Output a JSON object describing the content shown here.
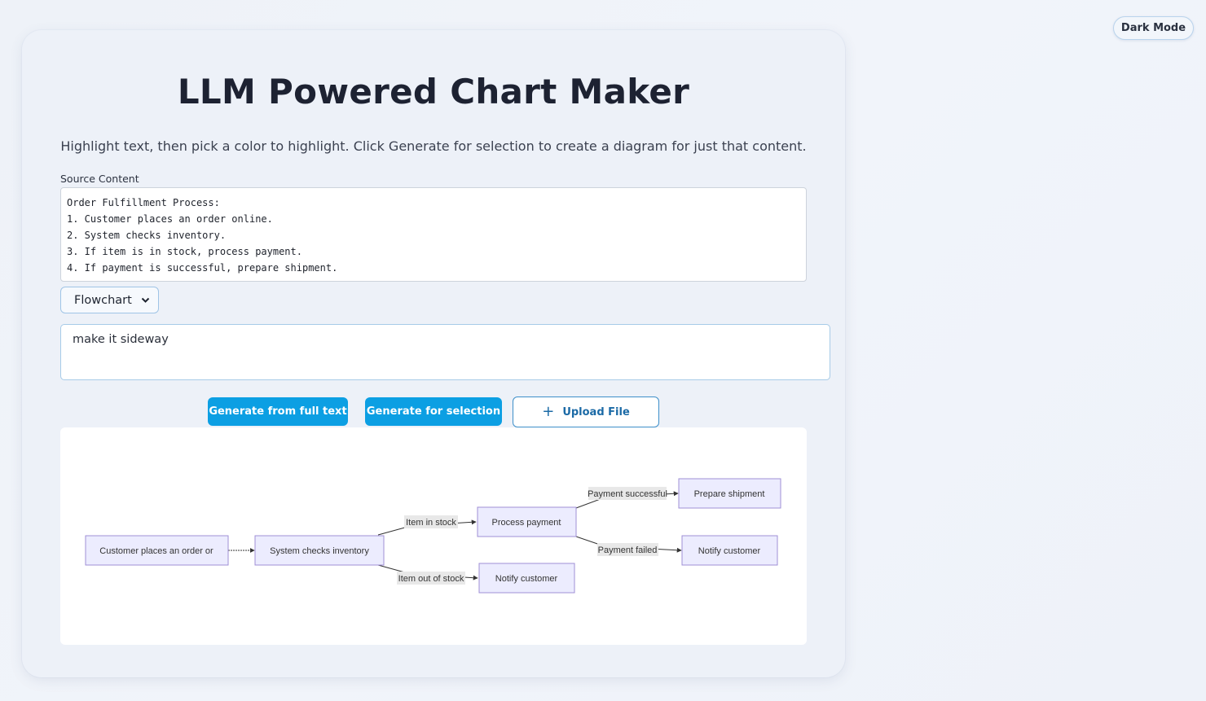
{
  "header": {
    "dark_mode_label": "Dark Mode"
  },
  "main": {
    "title": "LLM Powered Chart Maker",
    "subtitle": "Highlight text, then pick a color to highlight. Click Generate for selection to create a diagram for just that content.",
    "source_label": "Source Content",
    "source_lines": [
      "Order Fulfillment Process:",
      "1. Customer places an order online.",
      "2. System checks inventory.",
      "3. If item is in stock, process payment.",
      "4. If payment is successful, prepare shipment."
    ],
    "chart_type": {
      "selected": "Flowchart"
    },
    "prompt_value": "make it sideway",
    "buttons": {
      "generate_full": "Generate from full text",
      "generate_selection": "Generate for selection",
      "upload": "Upload File",
      "upload_icon": "plus-icon"
    }
  },
  "diagram": {
    "nodes": {
      "customer": "Customer places an order or",
      "inventory": "System checks inventory",
      "payment": "Process payment",
      "notify_out": "Notify customer",
      "shipment": "Prepare shipment",
      "notify_failed": "Notify customer"
    },
    "edges": {
      "in_stock": "Item in stock",
      "out_of_stock": "Item out of stock",
      "pay_success": "Payment successful",
      "pay_failed": "Payment failed"
    }
  }
}
